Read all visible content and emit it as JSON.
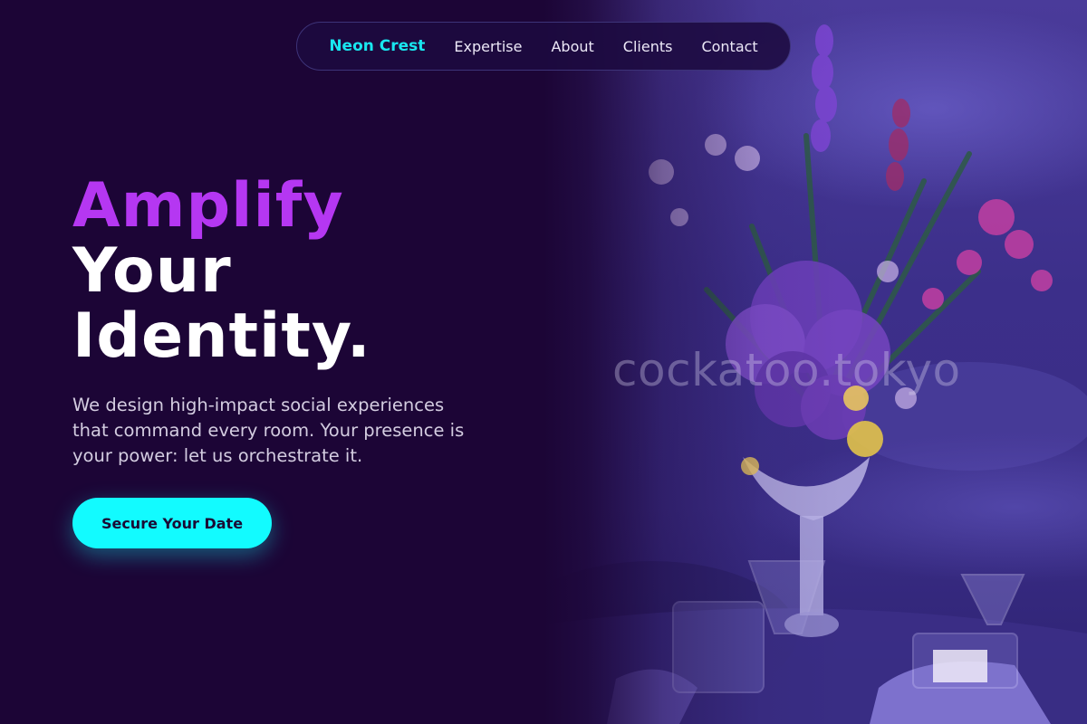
{
  "nav": {
    "brand": "Neon Crest",
    "links": [
      "Expertise",
      "About",
      "Clients",
      "Contact"
    ]
  },
  "hero": {
    "headline": [
      "Amplify",
      "Your",
      "Identity."
    ],
    "subtitle": "We design high-impact social experiences that command every room. Your presence is your power: let us orchestrate it.",
    "cta_label": "Secure Your Date",
    "image_watermark": "cockatoo.tokyo"
  },
  "colors": {
    "background": "#1c0536",
    "accent_cyan": "#12fbff",
    "brand_cyan": "#19e6ef",
    "headline_purple": "#b537f2",
    "text_light": "#d3cce0"
  },
  "icons": {
    "hero_image": "floral-centerpiece-photo"
  }
}
